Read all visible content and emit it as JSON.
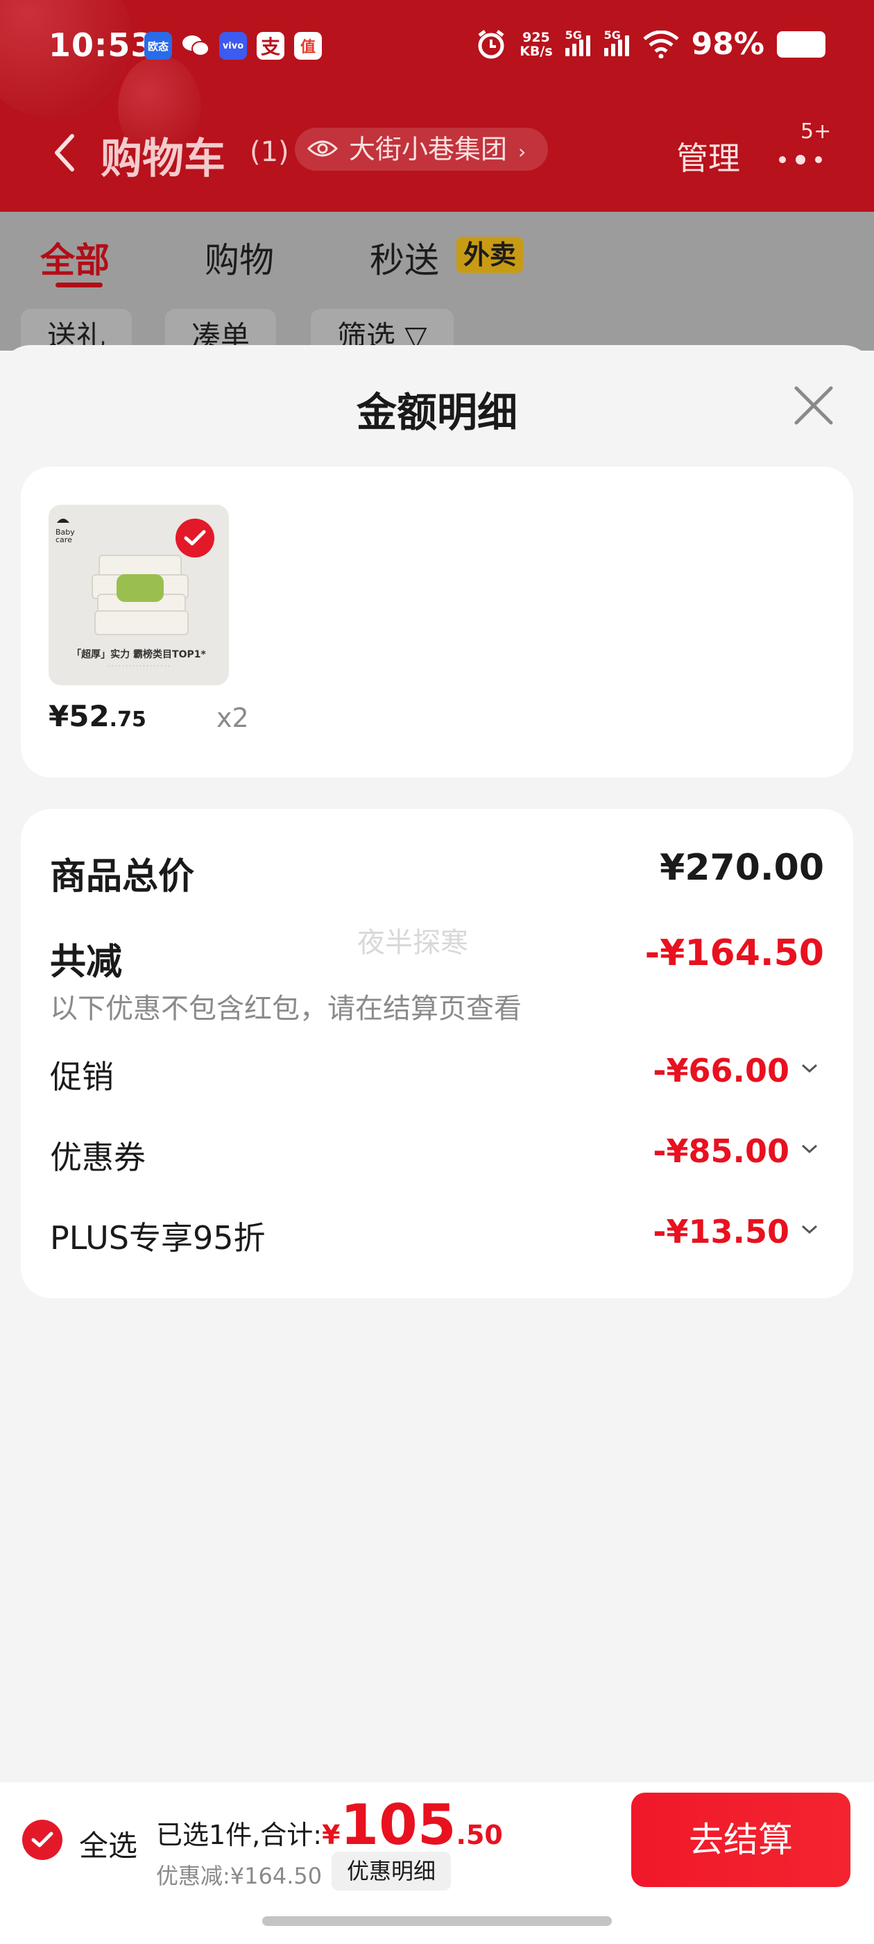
{
  "status_bar": {
    "time": "10:53",
    "app_icons": [
      {
        "name": "oppo-app-icon",
        "text": "欧态",
        "color": "#2a6be8"
      },
      {
        "name": "wechat-icon",
        "text": "",
        "color": "#ffffff"
      },
      {
        "name": "vivo-icon",
        "text": "vivo",
        "color": "#3d5af1"
      },
      {
        "name": "alipay-icon",
        "text": "支",
        "color": "#ffffff"
      },
      {
        "name": "smzdm-icon",
        "text": "值",
        "color": "#e8392b"
      }
    ],
    "net_speed_value": "925",
    "net_speed_unit": "KB/s",
    "sig1": "5G",
    "sig2": "5G",
    "battery": "98%"
  },
  "header": {
    "title": "购物车",
    "count": "(1)",
    "store": "大街小巷集团",
    "manage": "管理",
    "badge": "5+"
  },
  "tabs": [
    {
      "label": "全部",
      "active": true
    },
    {
      "label": "购物",
      "active": false
    },
    {
      "label": "秒送",
      "active": false
    }
  ],
  "tab_badge": "外卖",
  "chips": [
    "送礼",
    "凑单",
    "筛选 ▽"
  ],
  "sheet": {
    "title": "金额明细",
    "product": {
      "price_int": "¥52",
      "price_dec": ".75",
      "qty": "x2",
      "image_caption": "「超厚」实力 霸榜类目TOP1*",
      "image_logo": "Baby care"
    },
    "summary": {
      "total_label": "商品总价",
      "total_value": "¥270.00",
      "reduce_label": "共减",
      "reduce_value": "-¥164.50",
      "note": "以下优惠不包含红包，请在结算页查看",
      "watermark": "夜半探寒",
      "details": [
        {
          "label": "促销",
          "value": "-¥66.00"
        },
        {
          "label": "优惠券",
          "value": "-¥85.00"
        },
        {
          "label": "PLUS专享95折",
          "value": "-¥13.50"
        }
      ]
    }
  },
  "bottom": {
    "select_all": "全选",
    "selected_text": "已选1件,合计:",
    "yen": "¥",
    "total_int": "105",
    "total_dec": ".50",
    "discount_text": "优惠减:¥164.50",
    "discount_button": "优惠明细",
    "checkout": "去结算"
  },
  "colors": {
    "brand_red": "#e8111f",
    "header_red": "#b8121c"
  }
}
